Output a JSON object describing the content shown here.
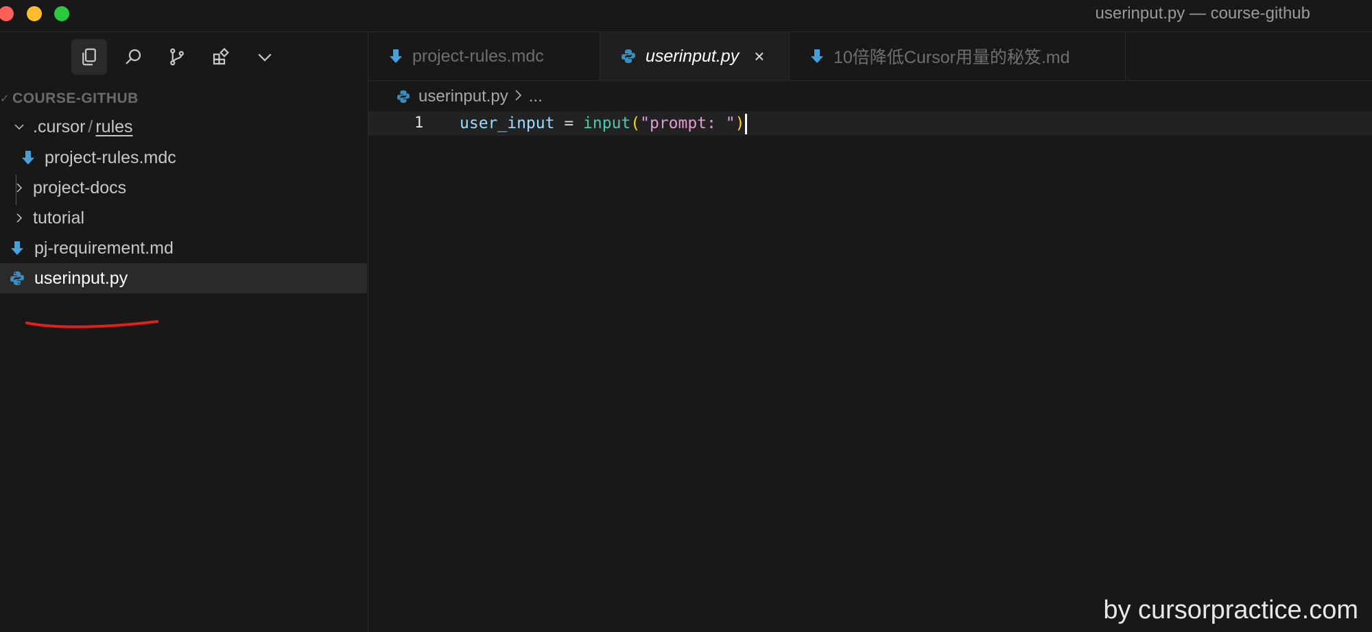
{
  "window": {
    "title": "userinput.py — course-github"
  },
  "activity_bar": {
    "items": [
      "explorer-icon",
      "search-icon",
      "source-control-icon",
      "extensions-icon",
      "chevron-down-icon"
    ]
  },
  "explorer": {
    "section_title": "COURSE-GITHUB",
    "tree": [
      {
        "label_part1": ".cursor",
        "separator": "/",
        "label_part2": "rules",
        "kind": "folder",
        "expanded": true
      },
      {
        "label": "project-rules.mdc",
        "kind": "file-md"
      },
      {
        "label": "project-docs",
        "kind": "folder",
        "expanded": false
      },
      {
        "label": "tutorial",
        "kind": "folder",
        "expanded": false
      },
      {
        "label": "pj-requirement.md",
        "kind": "file-md"
      },
      {
        "label": "userinput.py",
        "kind": "file-py",
        "selected": true
      }
    ]
  },
  "tabs": [
    {
      "label": "project-rules.mdc",
      "icon": "markdown-icon",
      "active": false
    },
    {
      "label": "userinput.py",
      "icon": "python-icon",
      "active": true,
      "close": "×"
    },
    {
      "label": "10倍降低Cursor用量的秘笈.md",
      "icon": "markdown-icon",
      "active": false
    }
  ],
  "breadcrumb": {
    "file": "userinput.py",
    "rest": "..."
  },
  "editor": {
    "line_number": "1",
    "tokens": {
      "var": "user_input",
      "op": " = ",
      "fn": "input",
      "lparen": "(",
      "str": "\"prompt: \"",
      "rparen": ")"
    }
  },
  "watermark": "by cursorpractice.com",
  "colors": {
    "background": "#181818",
    "python_icon": "#3c8dbc",
    "markdown_icon": "#4a9fd6",
    "annotation_red": "#e0201a"
  }
}
